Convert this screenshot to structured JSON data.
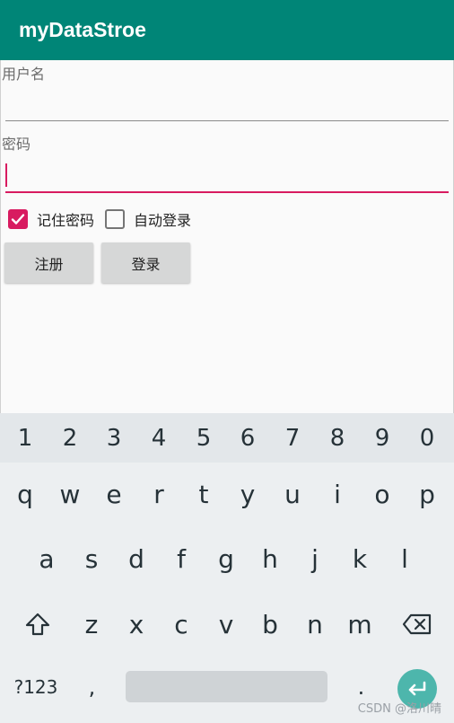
{
  "app": {
    "title": "myDataStroe"
  },
  "form": {
    "username_label": "用户名",
    "username_value": "",
    "password_label": "密码",
    "password_value": "",
    "remember_label": "记住密码",
    "remember_checked": true,
    "autologin_label": "自动登录",
    "autologin_checked": false,
    "register_label": "注册",
    "login_label": "登录"
  },
  "keyboard": {
    "numbers": [
      "1",
      "2",
      "3",
      "4",
      "5",
      "6",
      "7",
      "8",
      "9",
      "0"
    ],
    "row1": [
      "q",
      "w",
      "e",
      "r",
      "t",
      "y",
      "u",
      "i",
      "o",
      "p"
    ],
    "row2": [
      "a",
      "s",
      "d",
      "f",
      "g",
      "h",
      "j",
      "k",
      "l"
    ],
    "row3": [
      "z",
      "x",
      "c",
      "v",
      "b",
      "n",
      "m"
    ],
    "symbols_label": "?123",
    "comma": ",",
    "period": ".",
    "icons": {
      "shift": "shift-icon",
      "backspace": "backspace-icon",
      "enter": "enter-icon"
    },
    "colors": {
      "accent": "#4db6ac"
    }
  },
  "colors": {
    "appbar": "#008577",
    "accent": "#d81b60"
  },
  "watermark": "CSDN @洛川晴"
}
